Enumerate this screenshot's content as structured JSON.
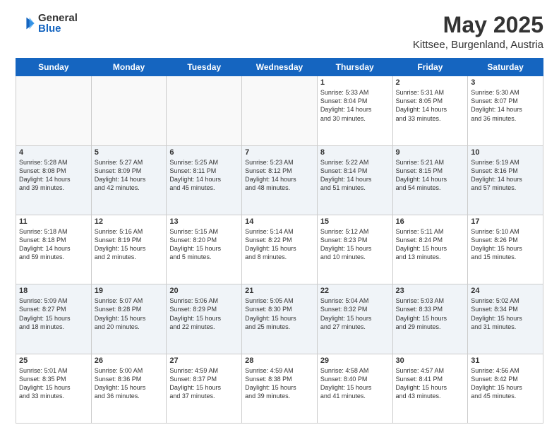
{
  "header": {
    "logo_general": "General",
    "logo_blue": "Blue",
    "month_title": "May 2025",
    "location": "Kittsee, Burgenland, Austria"
  },
  "days_of_week": [
    "Sunday",
    "Monday",
    "Tuesday",
    "Wednesday",
    "Thursday",
    "Friday",
    "Saturday"
  ],
  "weeks": [
    [
      {
        "day": "",
        "info": ""
      },
      {
        "day": "",
        "info": ""
      },
      {
        "day": "",
        "info": ""
      },
      {
        "day": "",
        "info": ""
      },
      {
        "day": "1",
        "info": "Sunrise: 5:33 AM\nSunset: 8:04 PM\nDaylight: 14 hours\nand 30 minutes."
      },
      {
        "day": "2",
        "info": "Sunrise: 5:31 AM\nSunset: 8:05 PM\nDaylight: 14 hours\nand 33 minutes."
      },
      {
        "day": "3",
        "info": "Sunrise: 5:30 AM\nSunset: 8:07 PM\nDaylight: 14 hours\nand 36 minutes."
      }
    ],
    [
      {
        "day": "4",
        "info": "Sunrise: 5:28 AM\nSunset: 8:08 PM\nDaylight: 14 hours\nand 39 minutes."
      },
      {
        "day": "5",
        "info": "Sunrise: 5:27 AM\nSunset: 8:09 PM\nDaylight: 14 hours\nand 42 minutes."
      },
      {
        "day": "6",
        "info": "Sunrise: 5:25 AM\nSunset: 8:11 PM\nDaylight: 14 hours\nand 45 minutes."
      },
      {
        "day": "7",
        "info": "Sunrise: 5:23 AM\nSunset: 8:12 PM\nDaylight: 14 hours\nand 48 minutes."
      },
      {
        "day": "8",
        "info": "Sunrise: 5:22 AM\nSunset: 8:14 PM\nDaylight: 14 hours\nand 51 minutes."
      },
      {
        "day": "9",
        "info": "Sunrise: 5:21 AM\nSunset: 8:15 PM\nDaylight: 14 hours\nand 54 minutes."
      },
      {
        "day": "10",
        "info": "Sunrise: 5:19 AM\nSunset: 8:16 PM\nDaylight: 14 hours\nand 57 minutes."
      }
    ],
    [
      {
        "day": "11",
        "info": "Sunrise: 5:18 AM\nSunset: 8:18 PM\nDaylight: 14 hours\nand 59 minutes."
      },
      {
        "day": "12",
        "info": "Sunrise: 5:16 AM\nSunset: 8:19 PM\nDaylight: 15 hours\nand 2 minutes."
      },
      {
        "day": "13",
        "info": "Sunrise: 5:15 AM\nSunset: 8:20 PM\nDaylight: 15 hours\nand 5 minutes."
      },
      {
        "day": "14",
        "info": "Sunrise: 5:14 AM\nSunset: 8:22 PM\nDaylight: 15 hours\nand 8 minutes."
      },
      {
        "day": "15",
        "info": "Sunrise: 5:12 AM\nSunset: 8:23 PM\nDaylight: 15 hours\nand 10 minutes."
      },
      {
        "day": "16",
        "info": "Sunrise: 5:11 AM\nSunset: 8:24 PM\nDaylight: 15 hours\nand 13 minutes."
      },
      {
        "day": "17",
        "info": "Sunrise: 5:10 AM\nSunset: 8:26 PM\nDaylight: 15 hours\nand 15 minutes."
      }
    ],
    [
      {
        "day": "18",
        "info": "Sunrise: 5:09 AM\nSunset: 8:27 PM\nDaylight: 15 hours\nand 18 minutes."
      },
      {
        "day": "19",
        "info": "Sunrise: 5:07 AM\nSunset: 8:28 PM\nDaylight: 15 hours\nand 20 minutes."
      },
      {
        "day": "20",
        "info": "Sunrise: 5:06 AM\nSunset: 8:29 PM\nDaylight: 15 hours\nand 22 minutes."
      },
      {
        "day": "21",
        "info": "Sunrise: 5:05 AM\nSunset: 8:30 PM\nDaylight: 15 hours\nand 25 minutes."
      },
      {
        "day": "22",
        "info": "Sunrise: 5:04 AM\nSunset: 8:32 PM\nDaylight: 15 hours\nand 27 minutes."
      },
      {
        "day": "23",
        "info": "Sunrise: 5:03 AM\nSunset: 8:33 PM\nDaylight: 15 hours\nand 29 minutes."
      },
      {
        "day": "24",
        "info": "Sunrise: 5:02 AM\nSunset: 8:34 PM\nDaylight: 15 hours\nand 31 minutes."
      }
    ],
    [
      {
        "day": "25",
        "info": "Sunrise: 5:01 AM\nSunset: 8:35 PM\nDaylight: 15 hours\nand 33 minutes."
      },
      {
        "day": "26",
        "info": "Sunrise: 5:00 AM\nSunset: 8:36 PM\nDaylight: 15 hours\nand 36 minutes."
      },
      {
        "day": "27",
        "info": "Sunrise: 4:59 AM\nSunset: 8:37 PM\nDaylight: 15 hours\nand 37 minutes."
      },
      {
        "day": "28",
        "info": "Sunrise: 4:59 AM\nSunset: 8:38 PM\nDaylight: 15 hours\nand 39 minutes."
      },
      {
        "day": "29",
        "info": "Sunrise: 4:58 AM\nSunset: 8:40 PM\nDaylight: 15 hours\nand 41 minutes."
      },
      {
        "day": "30",
        "info": "Sunrise: 4:57 AM\nSunset: 8:41 PM\nDaylight: 15 hours\nand 43 minutes."
      },
      {
        "day": "31",
        "info": "Sunrise: 4:56 AM\nSunset: 8:42 PM\nDaylight: 15 hours\nand 45 minutes."
      }
    ]
  ]
}
